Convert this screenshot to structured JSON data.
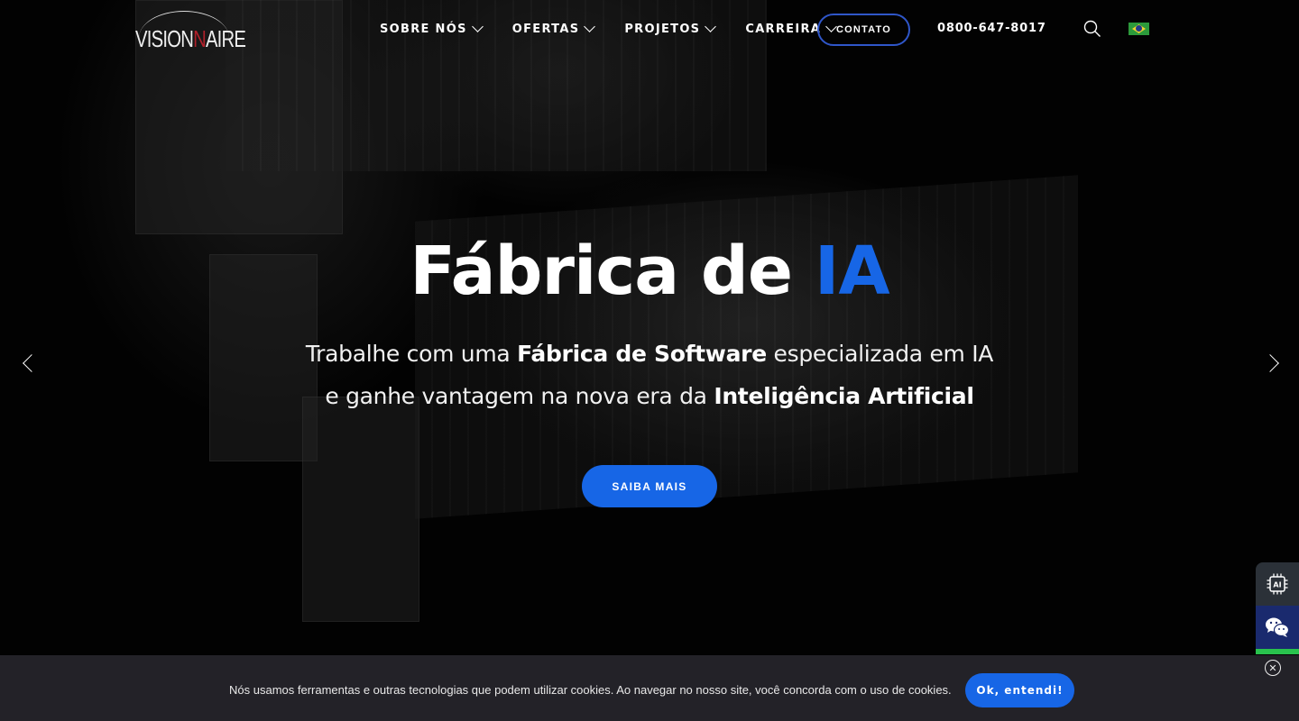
{
  "brand": {
    "logo_text_a": "VISION",
    "logo_text_mark": "N",
    "logo_text_b": "AIRE"
  },
  "nav": {
    "items": [
      {
        "label": "SOBRE NÓS",
        "icon": "chevron-down-icon"
      },
      {
        "label": "OFERTAS",
        "icon": "chevron-down-icon"
      },
      {
        "label": "PROJETOS",
        "icon": "chevron-down-icon"
      },
      {
        "label": "CARREIRA",
        "icon": "chevron-down-icon"
      }
    ],
    "contact_label": "CONTATO",
    "phone": "0800-647-8017",
    "search_icon": "search-icon",
    "language_icon": "brazil-flag-icon"
  },
  "hero": {
    "title_main": "Fábrica de ",
    "title_accent": "IA",
    "subtitle_line1_a": "Trabalhe com uma ",
    "subtitle_line1_bold": "Fábrica de Software",
    "subtitle_line1_b": " especializada em IA",
    "subtitle_line2_a": "e ganhe vantagem na nova era da ",
    "subtitle_line2_bold": "Inteligência Artificial",
    "cta_label": "SAIBA MAIS",
    "prev_icon": "chevron-left-icon",
    "next_icon": "chevron-right-icon"
  },
  "side_widgets": {
    "ai_icon": "ai-chip-icon",
    "chat_icon": "wechat-icon"
  },
  "cookie": {
    "text": "Nós usamos ferramentas e outras tecnologias que podem utilizar cookies. Ao navegar no nosso site, você concorda com o uso de cookies.",
    "accept_label": "Ok, entendi!",
    "close_symbol": "✕"
  },
  "colors": {
    "accent": "#1766e6",
    "contact_border": "#2f56c9",
    "logo_red": "#b0202a",
    "cookie_bg": "#232228",
    "wechat_bg": "#1a2a6e",
    "green_bar": "#29c24d"
  }
}
